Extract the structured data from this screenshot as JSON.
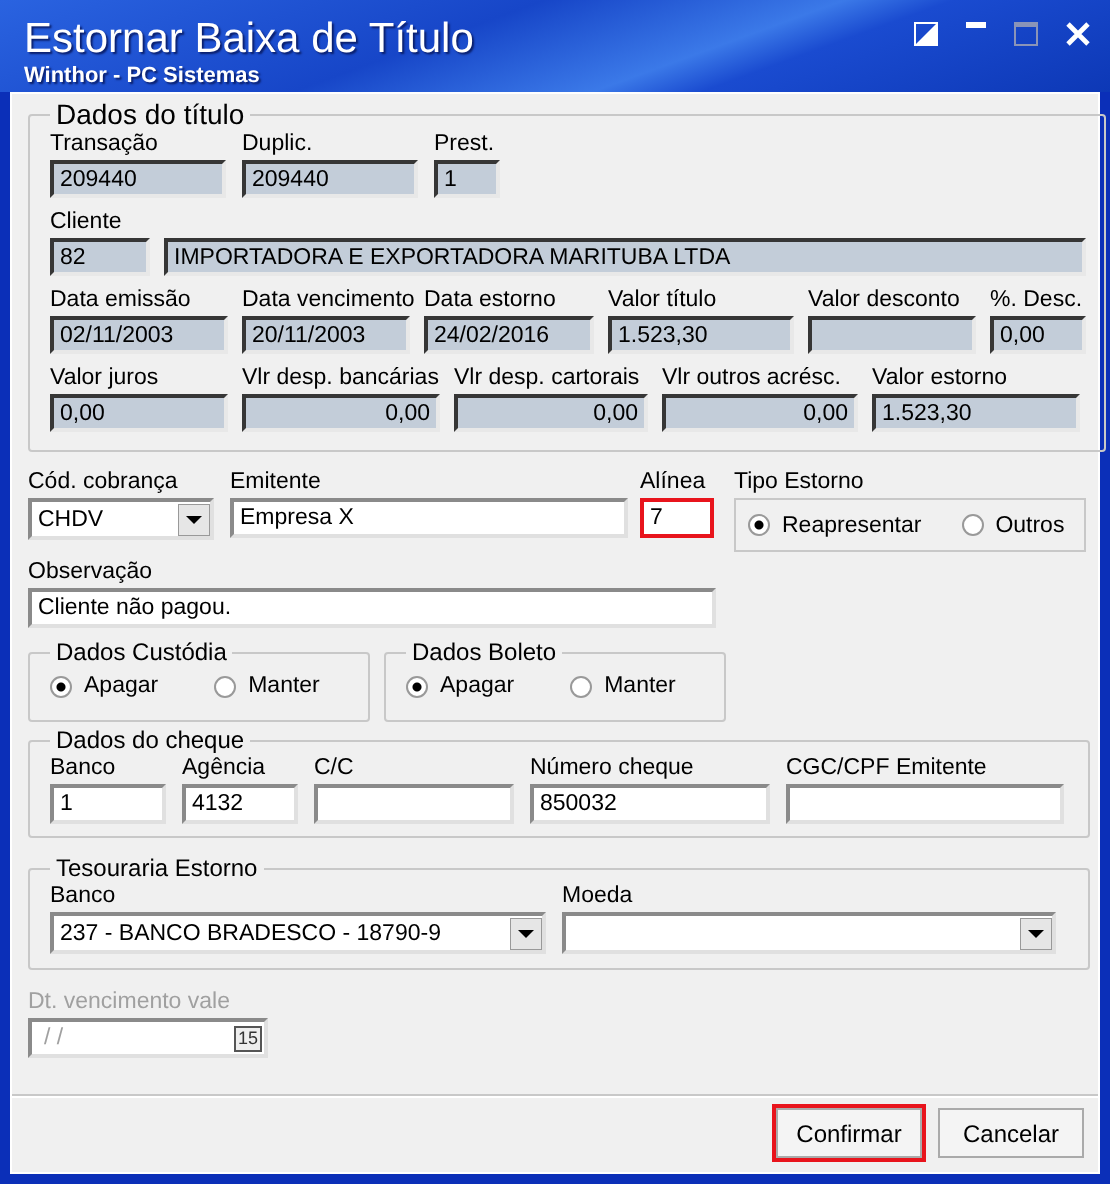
{
  "window": {
    "title": "Estornar Baixa de Título",
    "subtitle": "Winthor - PC Sistemas"
  },
  "titulo": {
    "title": "Dados do título",
    "rows": [
      [
        {
          "label": "Transação",
          "value": "209440",
          "kind": "text"
        },
        {
          "label": "Duplic.",
          "value": "209440",
          "kind": "text"
        },
        {
          "label": "Prest.",
          "value": "1",
          "kind": "text"
        }
      ],
      [
        {
          "label": "Cliente",
          "value": "82",
          "kind": "text"
        },
        {
          "value": "IMPORTADORA E EXPORTADORA MARITUBA LTDA",
          "kind": "text"
        }
      ],
      [
        {
          "label": "Data emissão",
          "value": "02/11/2003",
          "kind": "text"
        },
        {
          "label": "Data vencimento",
          "value": "20/11/2003",
          "kind": "text"
        },
        {
          "label": "Data estorno",
          "value": "24/02/2016",
          "kind": "text"
        },
        {
          "label": "Valor título",
          "value": "1.523,30",
          "kind": "text"
        },
        {
          "label": "Valor desconto",
          "kind": "text"
        },
        {
          "label": "%. Desc.",
          "value": "0,00",
          "kind": "text"
        }
      ],
      [
        {
          "label": "Valor juros",
          "value": "0,00",
          "kind": "text"
        },
        {
          "label": "Vlr desp. bancárias",
          "value": "0,00",
          "kind": "number"
        },
        {
          "label": "Vlr desp. cartorais",
          "value": "0,00",
          "kind": "number"
        },
        {
          "label": "Vlr outros acrésc.",
          "value": "0,00",
          "kind": "number"
        },
        {
          "label": "Valor estorno",
          "value": "1.523,30",
          "kind": "text"
        }
      ]
    ]
  },
  "cobranca": {
    "label": "Cód. cobrança",
    "value": "CHDV"
  },
  "emitente": {
    "label": "Emitente",
    "value": "Empresa X"
  },
  "alinea": {
    "label": "Alínea",
    "value": "7",
    "highlighted": true
  },
  "tipo_estorno": {
    "title": "Tipo Estorno",
    "options": [
      {
        "label": "Reapresentar",
        "selected": true
      },
      {
        "label": "Outros",
        "selected": false
      }
    ]
  },
  "observacao": {
    "label": "Observação",
    "value": "Cliente não pagou."
  },
  "custodia": {
    "title": "Dados Custódia",
    "options": [
      {
        "label": "Apagar",
        "selected": true
      },
      {
        "label": "Manter",
        "selected": false
      }
    ]
  },
  "boleto": {
    "title": "Dados Boleto",
    "options": [
      {
        "label": "Apagar",
        "selected": true
      },
      {
        "label": "Manter",
        "selected": false
      }
    ]
  },
  "cheque": {
    "title": "Dados do cheque",
    "fields": [
      {
        "label": "Banco",
        "value": "1"
      },
      {
        "label": "Agência",
        "value": "4132"
      },
      {
        "label": "C/C"
      },
      {
        "label": "Número cheque",
        "value": "850032"
      },
      {
        "label": "CGC/CPF Emitente"
      }
    ]
  },
  "tesouraria": {
    "title": "Tesouraria Estorno",
    "fields": [
      {
        "label": "Banco",
        "value": "237 - BANCO BRADESCO - 18790-9"
      },
      {
        "label": "Moeda"
      }
    ]
  },
  "vencimento_vale": {
    "label": "Dt. vencimento vale",
    "value": "/ /",
    "disabled": true,
    "calendar_day": "15"
  },
  "buttons": [
    {
      "label": "Confirmar",
      "highlighted": true
    },
    {
      "label": "Cancelar",
      "highlighted": false
    }
  ]
}
